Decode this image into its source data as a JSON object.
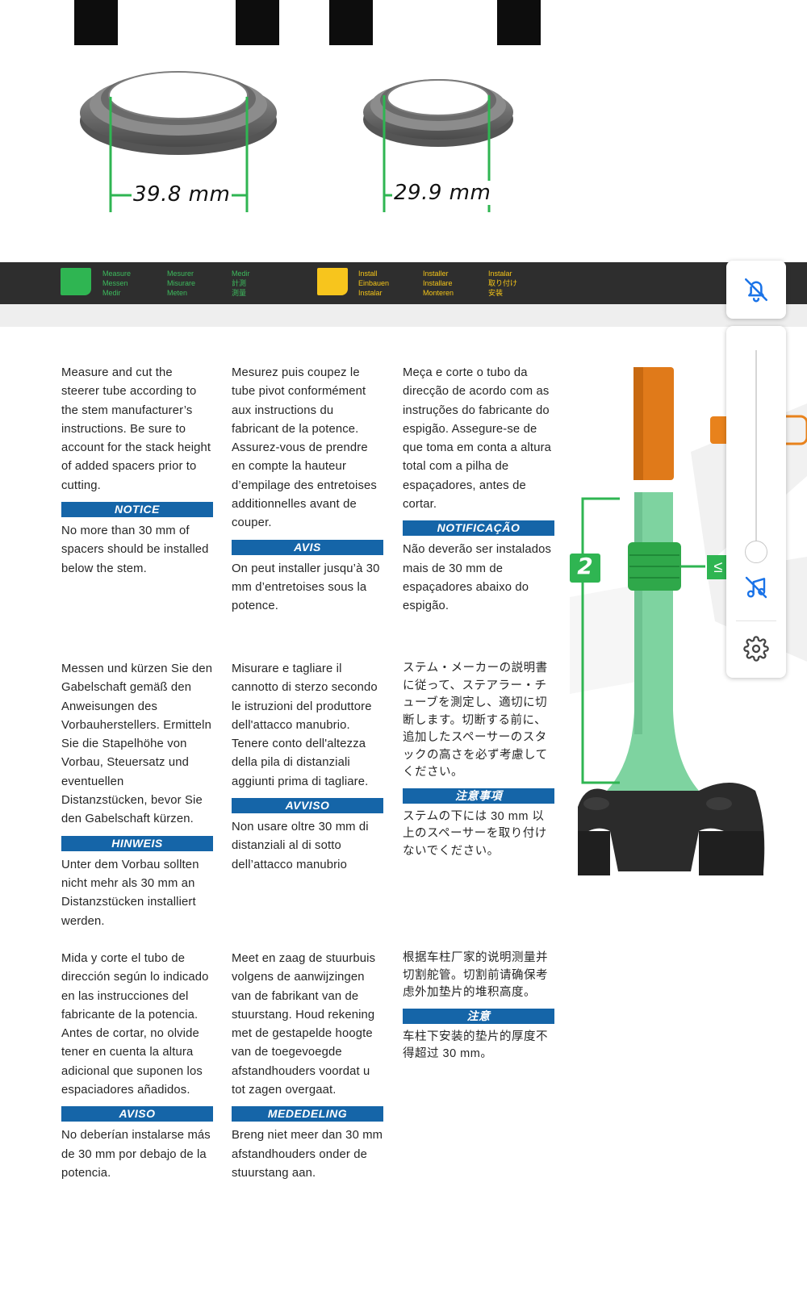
{
  "illustration": {
    "left_dimension": "39.8 mm",
    "right_dimension": "29.9 mm"
  },
  "legend": {
    "measure": [
      "Measure",
      "Messen",
      "Medir"
    ],
    "mesurer": [
      "Mesurer",
      "Misurare",
      "Meten"
    ],
    "medir": [
      "Medir",
      "計測",
      "測量"
    ],
    "install": [
      "Install",
      "Einbauen",
      "Instalar"
    ],
    "installer": [
      "Installer",
      "Installare",
      "Monteren"
    ],
    "instalar": [
      "Instalar",
      "取り付け",
      "安装"
    ],
    "measure_color": "#2fb552",
    "install_color": "#f7c51d"
  },
  "fork": {
    "step_number": "2",
    "lte_symbol": "≤",
    "spacer_color": "#2fa84a",
    "steerer_color": "#7ed3a0",
    "cut_color": "#e07a1a"
  },
  "blocks": {
    "en": {
      "body": "Measure and cut the steerer tube according to the stem manufacturer’s instructions. Be sure to account for the stack height of added spacers prior to cutting.",
      "notice_label": "NOTICE",
      "notice_body": "No more than 30 mm of spacers should be installed below the stem."
    },
    "fr": {
      "body": "Mesurez puis coupez le tube pivot conformément aux instructions du fabricant de la potence. Assurez-vous de prendre en compte la hauteur d’empilage des entretoises additionnelles avant de couper.",
      "notice_label": "AVIS",
      "notice_body": "On peut installer jusqu’à 30 mm d’entretoises sous la potence."
    },
    "pt": {
      "body": "Meça e corte o tubo da direcção de acordo com as instruções do fabricante do espigão. Assegure-se de que toma em conta a altura total com a  pilha de espaçadores, antes de cortar.",
      "notice_label": "NOTIFICAÇÃO",
      "notice_body": "Não deverão ser instalados mais de 30 mm de espaçadores abaixo do espigão."
    },
    "de": {
      "body": "Messen und kürzen Sie den Gabelschaft gemäß den Anweisungen des Vorbauherstellers. Ermitteln Sie die Stapelhöhe von Vorbau, Steuersatz und eventuellen Distanzstücken, bevor Sie den Gabelschaft kürzen.",
      "notice_label": "HINWEIS",
      "notice_body": "Unter dem Vorbau sollten nicht mehr als 30 mm an Distanzstücken installiert werden."
    },
    "it": {
      "body": "Misurare e tagliare il cannotto di sterzo secondo le istruzioni del produttore dell'attacco manubrio. Tenere conto dell'altezza della pila di distanziali aggiunti prima di tagliare.",
      "notice_label": "AVVISO",
      "notice_body": "Non usare oltre 30 mm di distanziali al di sotto dell’attacco manubrio"
    },
    "ja": {
      "body": "ステム・メーカーの説明書に従って、ステアラー・チューブを測定し、適切に切断します。切断する前に、追加したスペーサーのスタックの高さを必ず考慮してください。",
      "notice_label": "注意事項",
      "notice_body": "ステムの下には 30 mm 以上のスペーサーを取り付けないでください。"
    },
    "es": {
      "body": "Mida y corte el tubo de dirección según lo indicado en las instrucciones del fabricante de la potencia. Antes de cortar, no olvide tener en cuenta la altura adicional que suponen los espaciadores añadidos.",
      "notice_label": "AVISO",
      "notice_body": "No deberían instalarse más de 30 mm por debajo de la potencia."
    },
    "nl": {
      "body": "Meet en zaag de stuurbuis volgens de aanwijzingen van de fabrikant van de stuurstang. Houd rekening met de gestapelde hoogte van de toegevoegde afstandhouders voordat u tot zagen overgaat.",
      "notice_label": "MEDEDELING",
      "notice_body": "Breng niet meer dan 30 mm afstandhouders onder de stuurstang aan."
    },
    "zh": {
      "body": "根据车柱厂家的说明测量并切割舵管。切割前请确保考虑外加垫片的堆积高度。",
      "notice_label": "注意",
      "notice_body": "车柱下安装的垫片的厚度不得超过 30 mm。"
    }
  },
  "controls": {
    "slider_level": 0.0,
    "accent_color": "#1a73e8"
  }
}
